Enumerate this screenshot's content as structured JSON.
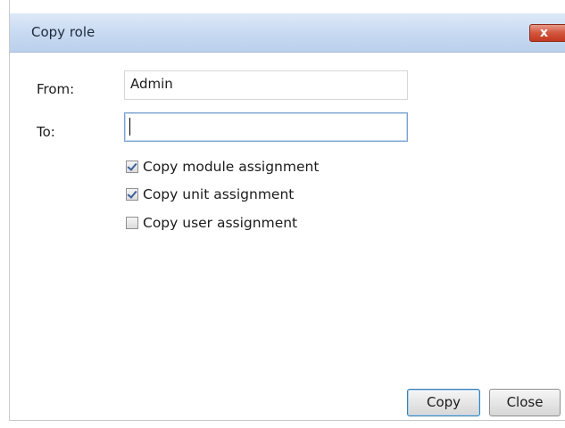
{
  "dialog": {
    "title": "Copy role",
    "close_glyph": "x"
  },
  "form": {
    "from_label": "From:",
    "from_value": "Admin",
    "to_label": "To:",
    "to_value": ""
  },
  "options": [
    {
      "label": "Copy module assignment",
      "checked": true
    },
    {
      "label": "Copy unit assignment",
      "checked": true
    },
    {
      "label": "Copy user assignment",
      "checked": false
    }
  ],
  "buttons": {
    "copy_label": "Copy",
    "close_label": "Close"
  },
  "colors": {
    "titlebar": "#c6d9f1",
    "close_button": "#d2553d",
    "active_field_border": "#7da2ce",
    "default_button_border": "#3c7fb1"
  },
  "icons": {
    "close": "close-icon",
    "check": "checkmark-icon"
  }
}
